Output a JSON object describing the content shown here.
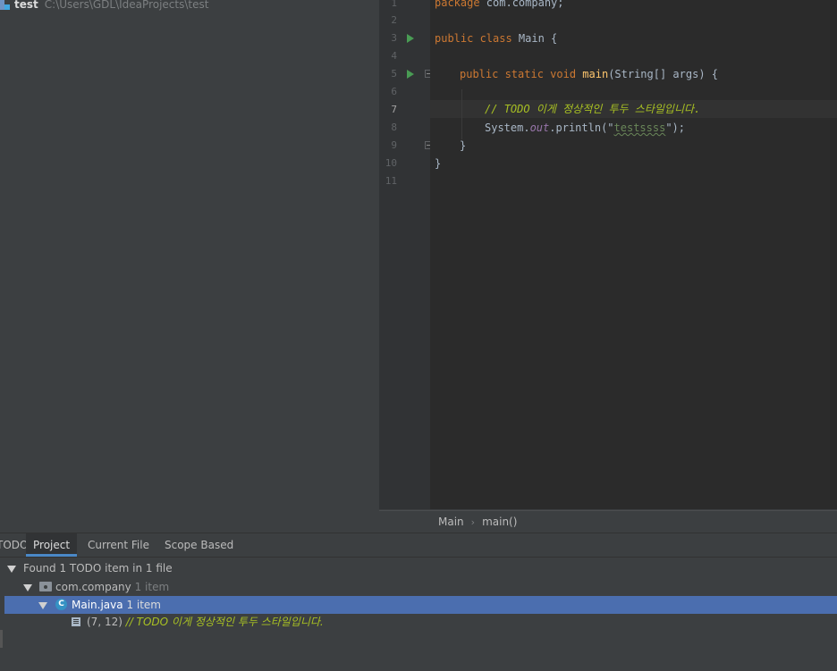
{
  "project": {
    "root_name": "test",
    "root_path": "C:\\Users\\GDL\\IdeaProjects\\test"
  },
  "editor": {
    "line_numbers": [
      "1",
      "2",
      "3",
      "4",
      "5",
      "6",
      "7",
      "8",
      "9",
      "10",
      "11"
    ],
    "lines": {
      "l1_kw": "package",
      "l1_rest": " com.company;",
      "l3_kw": "public class",
      "l3_rest": " Main {",
      "l5_kw": "public static void",
      "l5_fn": "main",
      "l5_rest": "(String[] args) {",
      "l7_slash": "// ",
      "l7_todo": "TODO 이게 정상적인 투두 스타일입니다.",
      "l8_a": "System.",
      "l8_field": "out",
      "l8_b": ".println(\"",
      "l8_str": "testssss",
      "l8_c": "\");",
      "l9": "}",
      "l10": "}"
    }
  },
  "breadcrumb": {
    "items": [
      "Main",
      "main()"
    ],
    "separator": "›"
  },
  "todo_panel": {
    "label": "TODO:",
    "tabs": [
      "Project",
      "Current File",
      "Scope Based"
    ],
    "summary": "Found 1 TODO item in 1 file",
    "package_name": "com.company",
    "package_count": "1 item",
    "file_name": "Main.java",
    "file_count": "1 item",
    "item_position": "(7, 12)",
    "item_slash": "//",
    "item_text": "TODO 이게 정상적인 투두 스타일입니다."
  },
  "colors": {
    "keyword": "#cc7832",
    "todo": "#a8c023",
    "selection": "#4b6eaf",
    "tab_underline": "#4a88c7"
  }
}
